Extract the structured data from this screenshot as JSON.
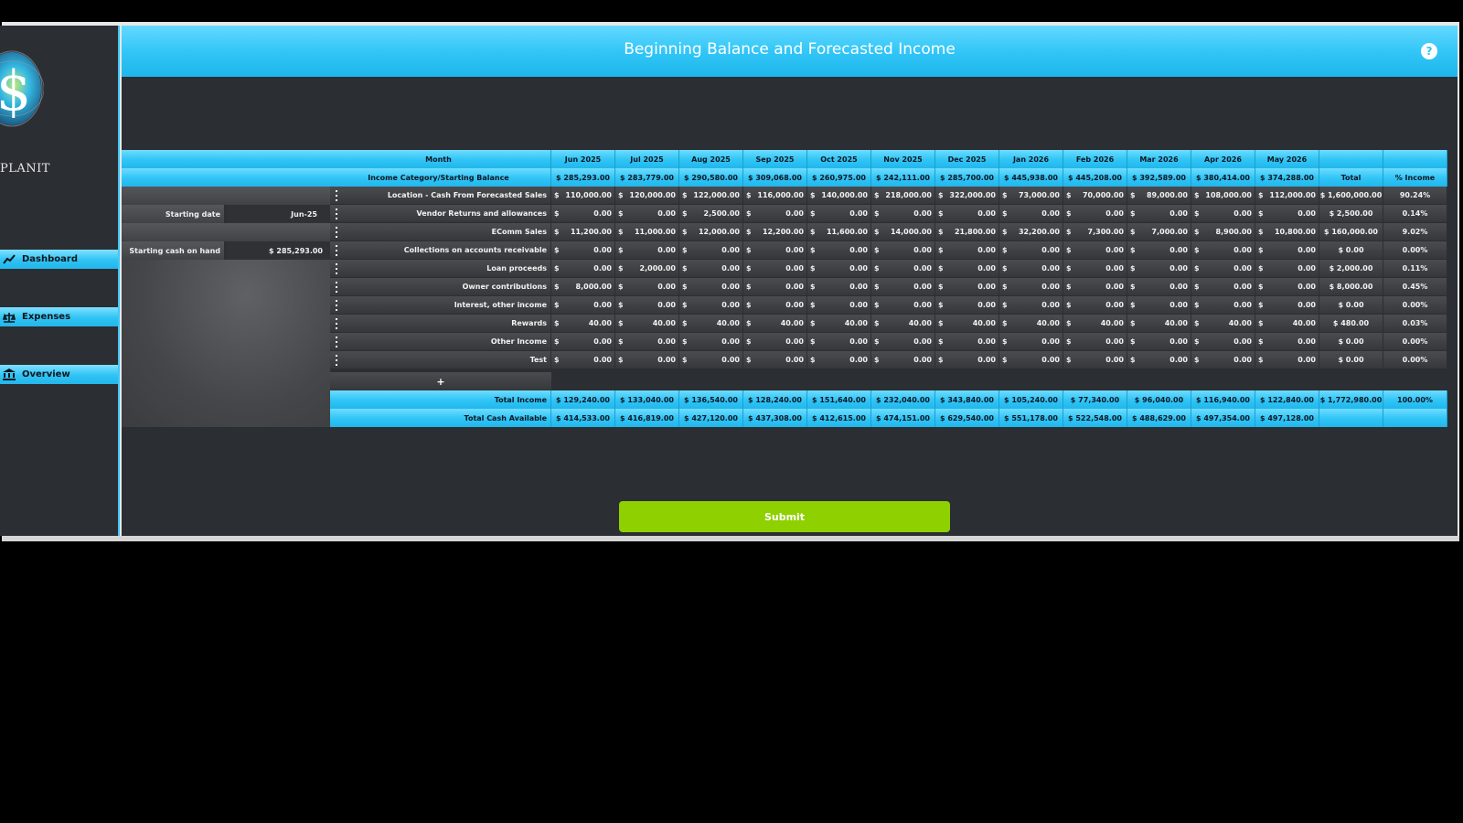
{
  "header": {
    "title": "Beginning Balance and Forecasted Income",
    "help_icon": "question-circle-icon"
  },
  "sidebar": {
    "logo_text": "PLANIT",
    "items": [
      {
        "label": "Dashboard",
        "icon": "chart-line-icon"
      },
      {
        "label": "Expenses",
        "icon": "balance-scale-icon"
      },
      {
        "label": "Overview",
        "icon": "bank-icon"
      }
    ]
  },
  "settings": {
    "starting_date_label": "Starting date",
    "starting_date_value": "Jun-25",
    "starting_cash_label": "Starting cash on hand",
    "starting_cash_value": "$ 285,293.00"
  },
  "table": {
    "month_label": "Month",
    "category_label": "Income Category/Starting Balance",
    "months": [
      "Jun 2025",
      "Jul 2025",
      "Aug 2025",
      "Sep 2025",
      "Oct 2025",
      "Nov 2025",
      "Dec 2025",
      "Jan 2026",
      "Feb 2026",
      "Mar 2026",
      "Apr 2026",
      "May 2026"
    ],
    "starting_balances": [
      "$ 285,293.00",
      "$ 283,779.00",
      "$ 290,580.00",
      "$ 309,068.00",
      "$ 260,975.00",
      "$ 242,111.00",
      "$ 285,700.00",
      "$ 445,938.00",
      "$ 445,208.00",
      "$ 392,589.00",
      "$ 380,414.00",
      "$ 374,288.00"
    ],
    "total_label": "Total",
    "pct_label": "% Income",
    "currency_symbol": "$",
    "rows": [
      {
        "label": "Location  - Cash From Forecasted Sales",
        "values": [
          "110,000.00",
          "120,000.00",
          "122,000.00",
          "116,000.00",
          "140,000.00",
          "218,000.00",
          "322,000.00",
          "73,000.00",
          "70,000.00",
          "89,000.00",
          "108,000.00",
          "112,000.00"
        ],
        "total": "$ 1,600,000.00",
        "pct": "90.24%"
      },
      {
        "label": "Vendor Returns and allowances",
        "values": [
          "0.00",
          "0.00",
          "2,500.00",
          "0.00",
          "0.00",
          "0.00",
          "0.00",
          "0.00",
          "0.00",
          "0.00",
          "0.00",
          "0.00"
        ],
        "total": "$ 2,500.00",
        "pct": "0.14%"
      },
      {
        "label": "EComm Sales",
        "values": [
          "11,200.00",
          "11,000.00",
          "12,000.00",
          "12,200.00",
          "11,600.00",
          "14,000.00",
          "21,800.00",
          "32,200.00",
          "7,300.00",
          "7,000.00",
          "8,900.00",
          "10,800.00"
        ],
        "total": "$ 160,000.00",
        "pct": "9.02%"
      },
      {
        "label": "Collections on accounts receivable",
        "values": [
          "0.00",
          "0.00",
          "0.00",
          "0.00",
          "0.00",
          "0.00",
          "0.00",
          "0.00",
          "0.00",
          "0.00",
          "0.00",
          "0.00"
        ],
        "total": "$ 0.00",
        "pct": "0.00%"
      },
      {
        "label": "Loan proceeds",
        "values": [
          "0.00",
          "2,000.00",
          "0.00",
          "0.00",
          "0.00",
          "0.00",
          "0.00",
          "0.00",
          "0.00",
          "0.00",
          "0.00",
          "0.00"
        ],
        "total": "$ 2,000.00",
        "pct": "0.11%"
      },
      {
        "label": "Owner contributions",
        "values": [
          "8,000.00",
          "0.00",
          "0.00",
          "0.00",
          "0.00",
          "0.00",
          "0.00",
          "0.00",
          "0.00",
          "0.00",
          "0.00",
          "0.00"
        ],
        "total": "$ 8,000.00",
        "pct": "0.45%"
      },
      {
        "label": "Interest, other income",
        "values": [
          "0.00",
          "0.00",
          "0.00",
          "0.00",
          "0.00",
          "0.00",
          "0.00",
          "0.00",
          "0.00",
          "0.00",
          "0.00",
          "0.00"
        ],
        "total": "$ 0.00",
        "pct": "0.00%"
      },
      {
        "label": "Rewards",
        "values": [
          "40.00",
          "40.00",
          "40.00",
          "40.00",
          "40.00",
          "40.00",
          "40.00",
          "40.00",
          "40.00",
          "40.00",
          "40.00",
          "40.00"
        ],
        "total": "$ 480.00",
        "pct": "0.03%"
      },
      {
        "label": "Other Income",
        "values": [
          "0.00",
          "0.00",
          "0.00",
          "0.00",
          "0.00",
          "0.00",
          "0.00",
          "0.00",
          "0.00",
          "0.00",
          "0.00",
          "0.00"
        ],
        "total": "$ 0.00",
        "pct": "0.00%"
      },
      {
        "label": "Test",
        "values": [
          "0.00",
          "0.00",
          "0.00",
          "0.00",
          "0.00",
          "0.00",
          "0.00",
          "0.00",
          "0.00",
          "0.00",
          "0.00",
          "0.00"
        ],
        "total": "$ 0.00",
        "pct": "0.00%"
      }
    ],
    "add_row_label": "+",
    "total_income_label": "Total Income",
    "total_income": [
      "$ 129,240.00",
      "$ 133,040.00",
      "$ 136,540.00",
      "$ 128,240.00",
      "$ 151,640.00",
      "$ 232,040.00",
      "$ 343,840.00",
      "$ 105,240.00",
      "$ 77,340.00",
      "$ 96,040.00",
      "$ 116,940.00",
      "$ 122,840.00"
    ],
    "total_income_total": "$ 1,772,980.00",
    "total_income_pct": "100.00%",
    "total_cash_label": "Total Cash Available",
    "total_cash": [
      "$ 414,533.00",
      "$ 416,819.00",
      "$ 427,120.00",
      "$ 437,308.00",
      "$ 412,615.00",
      "$ 474,151.00",
      "$ 629,540.00",
      "$ 551,178.00",
      "$ 522,548.00",
      "$ 488,629.00",
      "$ 497,354.00",
      "$ 497,128.00"
    ]
  },
  "submit_label": "Submit",
  "colors": {
    "accent": "#33c6f7",
    "submit": "#8fd000",
    "background": "#2b2e33"
  }
}
